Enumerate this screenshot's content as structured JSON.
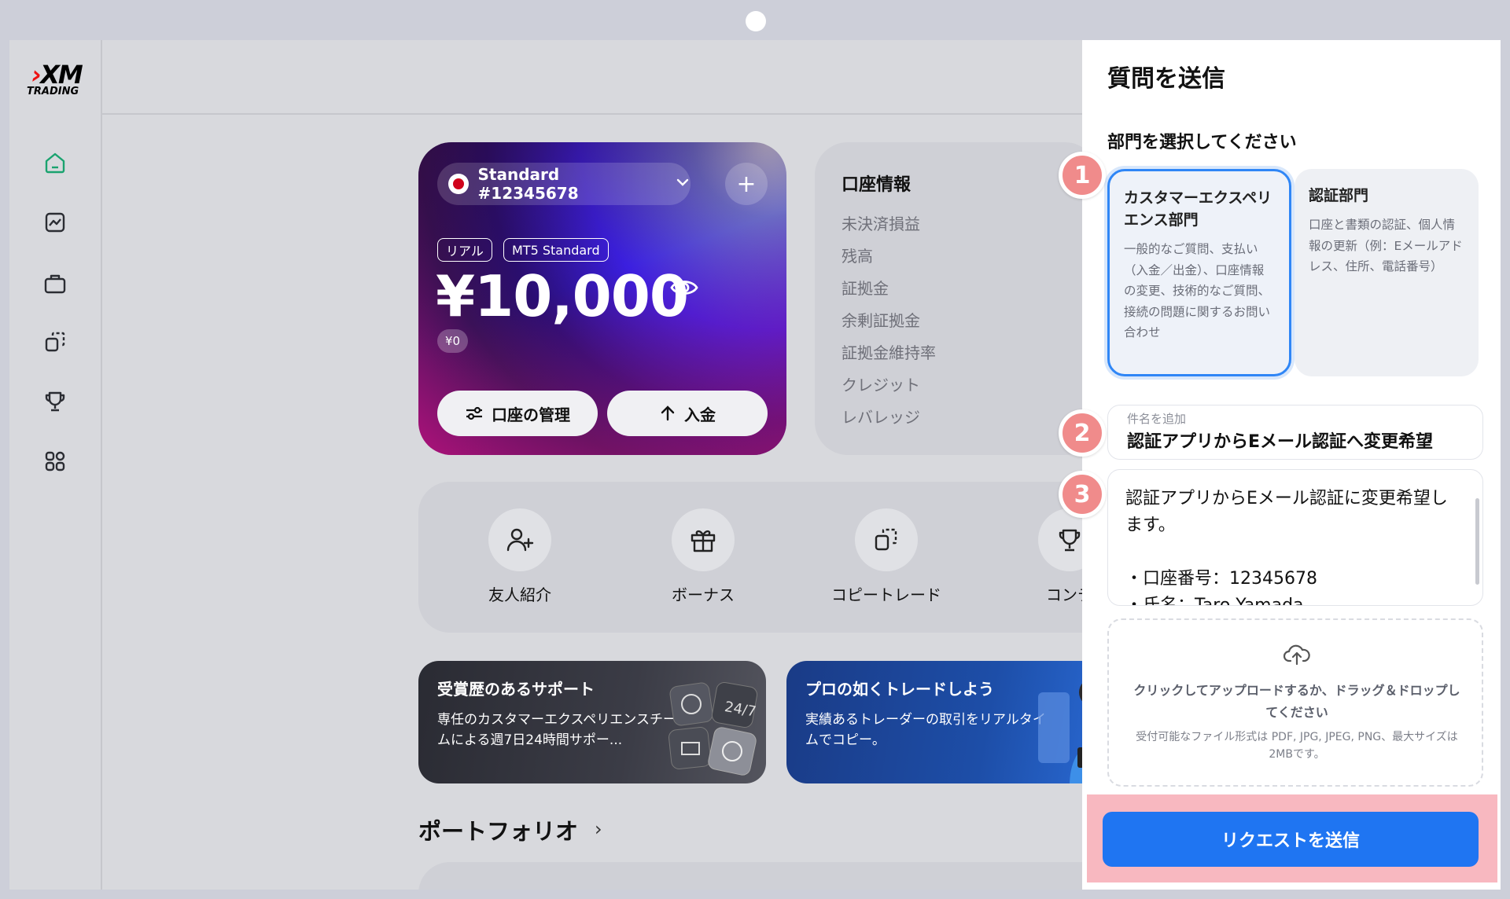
{
  "brand": {
    "logo_text": "XM",
    "logo_sub": "TRADING"
  },
  "sidebar": {
    "items": [
      {
        "icon": "home-icon",
        "active": true
      },
      {
        "icon": "chart-icon"
      },
      {
        "icon": "briefcase-icon"
      },
      {
        "icon": "copy-icon"
      },
      {
        "icon": "trophy-icon"
      },
      {
        "icon": "apps-icon"
      }
    ]
  },
  "account_card": {
    "account_name": "Standard #12345678",
    "tag_real": "リアル",
    "tag_platform": "MT5 Standard",
    "balance": "¥10,000",
    "sub_balance": "¥0",
    "manage_label": "口座の管理",
    "deposit_label": "入金"
  },
  "account_info": {
    "title": "口座情報",
    "items": [
      "未決済損益",
      "残高",
      "証拠金",
      "余剰証拠金",
      "証拠金維持率",
      "クレジット",
      "レバレッジ"
    ]
  },
  "quick_actions": [
    {
      "label": "友人紹介",
      "icon": "add-friend-icon"
    },
    {
      "label": "ボーナス",
      "icon": "gift-icon"
    },
    {
      "label": "コピートレード",
      "icon": "copy-trade-icon"
    },
    {
      "label": "コンテ",
      "icon": "trophy-icon"
    }
  ],
  "promos": [
    {
      "title": "受賞歴のあるサポート",
      "text": "専任のカスタマーエクスペリエンスチームによる週7日24時間サポー..."
    },
    {
      "title": "プロの如くトレードしよう",
      "text": "実績あるトレーダーの取引をリアルタイムでコピー。"
    }
  ],
  "portfolio_title": "ポートフォリオ",
  "drawer": {
    "title": "質問を送信",
    "subtitle": "部門を選択してください",
    "departments": [
      {
        "name": "カスタマーエクスペリエンス部門",
        "desc": "一般的なご質問、支払い（入金／出金）、口座情報の変更、技術的なご質問、接続の問題に関するお問い合わせ",
        "selected": true
      },
      {
        "name": "認証部門",
        "desc": "口座と書類の認証、個人情報の更新（例：Eメールアドレス、住所、電話番号）",
        "selected": false
      }
    ],
    "subject_label": "件名を追加",
    "subject_value": "認証アプリからEメール認証へ変更希望",
    "message_lines": [
      "認証アプリからEメール認証に変更希望し",
      "ます。",
      "",
      "・口座番号：12345678",
      "・氏名：Taro Yamada"
    ],
    "upload_main": "クリックしてアップロードするか、ドラッグ＆ドロップしてください",
    "upload_sub": "受付可能なファイル形式は PDF, JPG, JPEG, PNG、最大サイズは2MBです。",
    "submit_label": "リクエストを送信"
  },
  "steps": [
    "1",
    "2",
    "3"
  ],
  "colors": {
    "accent": "#1f75f2",
    "step_badge": "#f08b8b",
    "highlight": "#f8b8c0",
    "active_nav": "#1aa36f"
  }
}
